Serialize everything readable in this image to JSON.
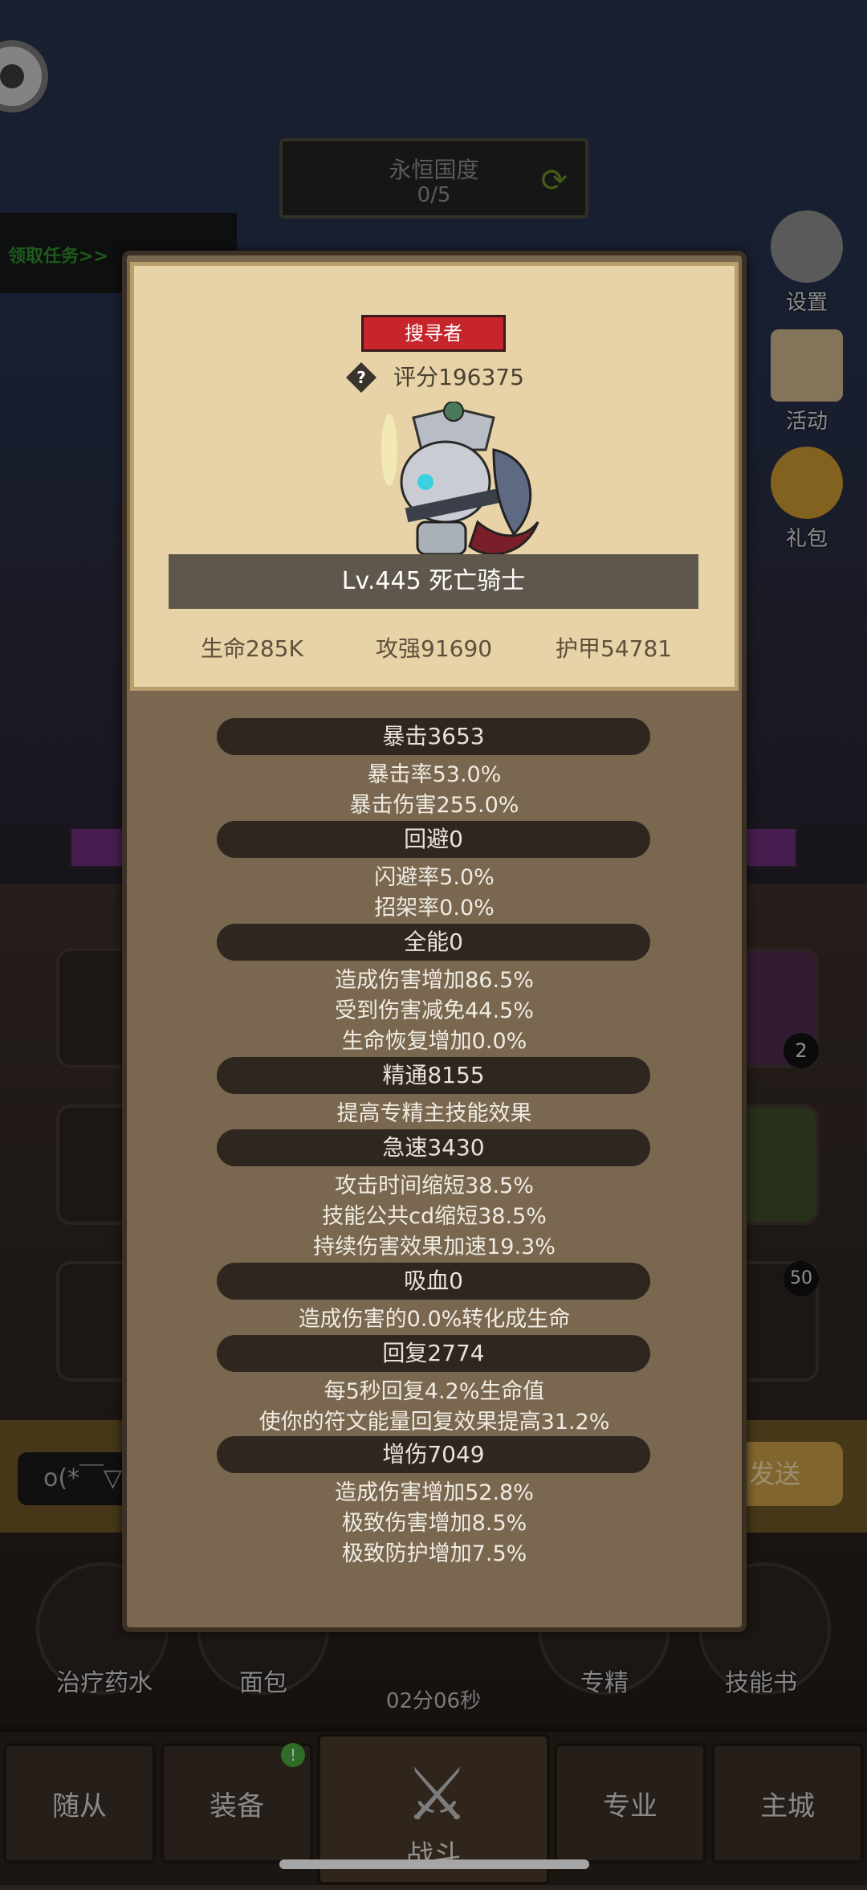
{
  "background": {
    "region": {
      "title": "永恒国度",
      "progress": "0/5"
    },
    "task_link": "领取任务>>",
    "side_buttons": [
      {
        "label": "设置",
        "icon": "gear-icon"
      },
      {
        "label": "活动",
        "icon": "scroll-icon"
      },
      {
        "label": "礼包",
        "icon": "giftbag-icon"
      }
    ],
    "slot_badges": [
      "2",
      "50"
    ],
    "chat": {
      "input_text": "o(*￣▽",
      "send_label": "发送"
    },
    "actions": [
      {
        "label": "治疗药水"
      },
      {
        "label": "面包"
      },
      {
        "label": "专精"
      },
      {
        "label": "技能书"
      }
    ],
    "timer": "02分06秒",
    "nav": [
      "随从",
      "装备",
      "战斗",
      "专业",
      "主城"
    ],
    "nav_badge": "!"
  },
  "popup": {
    "class_badge": "搜寻者",
    "score": "评分196375",
    "name": "Lv.445 死亡骑士",
    "main_stats": [
      "生命285K",
      "攻强91690",
      "护甲54781"
    ],
    "sections": [
      {
        "header": "暴击3653",
        "lines": [
          "暴击率53.0%",
          "暴击伤害255.0%"
        ]
      },
      {
        "header": "回避0",
        "lines": [
          "闪避率5.0%",
          "招架率0.0%"
        ]
      },
      {
        "header": "全能0",
        "lines": [
          "造成伤害增加86.5%",
          "受到伤害减免44.5%",
          "生命恢复增加0.0%"
        ]
      },
      {
        "header": "精通8155",
        "lines": [
          "提高专精主技能效果"
        ]
      },
      {
        "header": "急速3430",
        "lines": [
          "攻击时间缩短38.5%",
          "技能公共cd缩短38.5%",
          "持续伤害效果加速19.3%"
        ]
      },
      {
        "header": "吸血0",
        "lines": [
          "造成伤害的0.0%转化成生命"
        ]
      },
      {
        "header": "回复2774",
        "lines": [
          "每5秒回复4.2%生命值",
          "使你的符文能量回复效果提高31.2%"
        ]
      },
      {
        "header": "增伤7049",
        "lines": [
          "造成伤害增加52.8%",
          "极致伤害增加8.5%",
          "极致防护增加7.5%"
        ]
      }
    ]
  }
}
